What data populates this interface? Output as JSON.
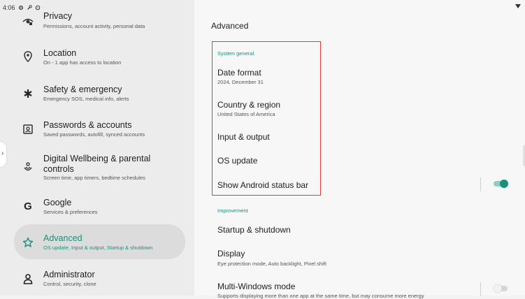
{
  "status_bar": {
    "time": "4:06"
  },
  "nav": [
    {
      "title": "Privacy",
      "subtitle": "Permissions, account activity, personal data",
      "icon": "privacy-icon"
    },
    {
      "title": "Location",
      "subtitle": "On - 1 app has access to location",
      "icon": "location-icon"
    },
    {
      "title": "Safety & emergency",
      "subtitle": "Emergency SOS, medical info, alerts",
      "icon": "asterisk-icon"
    },
    {
      "title": "Passwords & accounts",
      "subtitle": "Saved passwords, autofill, synced accounts",
      "icon": "account-box-icon"
    },
    {
      "title": "Digital Wellbeing & parental controls",
      "subtitle": "Screen time, app timers, bedtime schedules",
      "icon": "wellbeing-icon"
    },
    {
      "title": "Google",
      "subtitle": "Services & preferences",
      "icon": "google-icon"
    },
    {
      "title": "Advanced",
      "subtitle": "OS update, Input & output, Startup & shutdown",
      "icon": "advanced-icon",
      "selected": true
    },
    {
      "title": "Administrator",
      "subtitle": "Control, security, clone",
      "icon": "person-icon"
    }
  ],
  "page_title": "Advanced",
  "system_general": {
    "header": "System general",
    "date_format": {
      "title": "Date format",
      "subtitle": "2024, December 31"
    },
    "country_region": {
      "title": "Country & region",
      "subtitle": "United States of America"
    },
    "input_output": {
      "title": "Input & output"
    },
    "os_update": {
      "title": "OS update"
    },
    "status_bar_toggle": {
      "title": "Show Android status bar",
      "on": true
    }
  },
  "improvement": {
    "header": "Improvement",
    "startup_shutdown": {
      "title": "Startup & shutdown"
    },
    "display": {
      "title": "Display",
      "subtitle": "Eye protection mode, Auto backlight, Pixel shift"
    },
    "multi_windows": {
      "title": "Multi-Windows mode",
      "subtitle": "Supports displaying more than one app at the same time, but may consume more energy",
      "on": false
    }
  },
  "colors": {
    "accent": "#1a8f7c",
    "highlight_border": "#e53935"
  }
}
